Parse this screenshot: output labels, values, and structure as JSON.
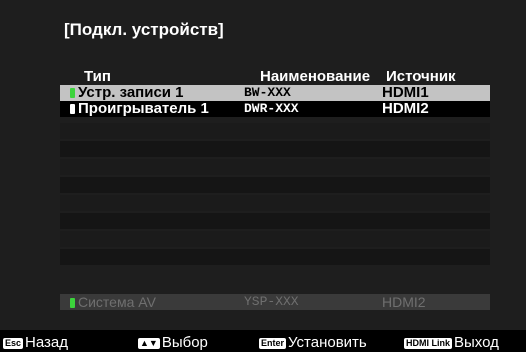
{
  "menu": {
    "title": "[Подкл. устройств]"
  },
  "columns": {
    "type": "Тип",
    "name": "Наименование",
    "source": "Источник"
  },
  "devices": [
    {
      "type": "Устр. записи 1",
      "name": "BW-XXX",
      "source": "HDMI1",
      "indicator_color": "#3cd33c"
    },
    {
      "type": "Проигрыватель 1",
      "name": "DWR-XXX",
      "source": "HDMI2",
      "indicator_color": "#ffffff"
    }
  ],
  "av_system": {
    "type": "Система AV",
    "name": "YSP-XXX",
    "source": "HDMI2",
    "indicator_color": "#3cd33c"
  },
  "footer": {
    "back_key": "Esc",
    "back_label": "Назад",
    "select_key": "▲▼",
    "select_label": "Выбор",
    "enter_key": "Enter",
    "enter_label": "Установить",
    "exit_key": "HDMI Link",
    "exit_label": "Выход"
  },
  "colors": {
    "background": "#1e1e1e",
    "selected_row": "#c3c3c3",
    "av_row": "#3a3a3a"
  }
}
